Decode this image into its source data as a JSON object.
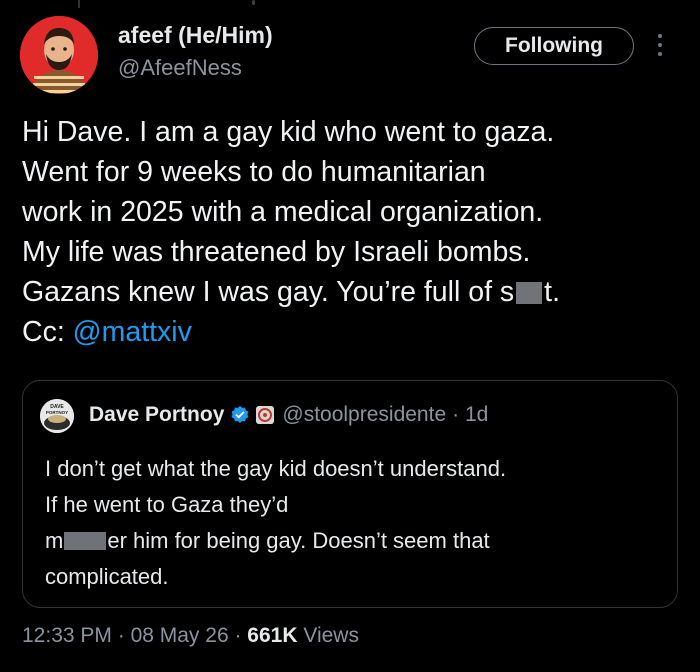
{
  "author": {
    "name": "afeef (He/Him)",
    "handle": "@AfeefNess",
    "avatar_color": "#e12b2b"
  },
  "follow_button_label": "Following",
  "more_icon": "more-vertical-icon",
  "tweet": {
    "lines": [
      "Hi Dave. I am a gay kid who went to gaza.",
      "Went for 9 weeks to do humanitarian",
      "work in 2025 with a medical organization.",
      "My life was threatened by Israeli bombs."
    ],
    "line5_before": "Gazans knew I was gay. You’re full of s",
    "line5_after": "t.",
    "cc_label": "Cc:",
    "cc_mention": "@mattxiv"
  },
  "quote": {
    "name": "Dave Portnoy",
    "handle": "@stoolpresidente",
    "time": "· 1d",
    "avatar_text_top": "DAVE",
    "avatar_text_bottom": "PORTNOY",
    "lines": [
      "I don’t get what the gay kid doesn’t understand.",
      "If he went to Gaza they’d"
    ],
    "line3_before": "m",
    "line3_after": "er him for being gay.  Doesn’t seem that",
    "line4": "complicated."
  },
  "meta": {
    "time": "12:33 PM",
    "sep1": " · ",
    "date": "08 May 26",
    "sep2": " · ",
    "views": "661K",
    "views_label": " Views"
  },
  "colors": {
    "background": "#000000",
    "mention": "#1d9bf0",
    "verified": "#1d9bf0",
    "secondary_text": "#8b949e"
  }
}
